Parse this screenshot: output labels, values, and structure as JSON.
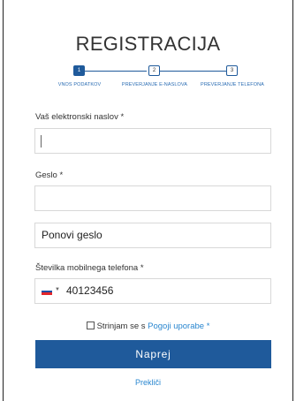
{
  "form": {
    "title": "REGISTRACIJA",
    "steps": [
      {
        "number": "1",
        "label": "VNOS PODATKOV",
        "active": true
      },
      {
        "number": "2",
        "label": "PREVERJANJE E-NASLOVA",
        "active": false
      },
      {
        "number": "3",
        "label": "PREVERJANJE TELEFONA",
        "active": false
      }
    ],
    "email": {
      "label": "Vaš elektronski naslov *",
      "value": ""
    },
    "password": {
      "label": "Geslo *",
      "value": ""
    },
    "repeat_password": {
      "placeholder": "Ponovi geslo"
    },
    "phone": {
      "label": "Številka mobilnega telefona *",
      "value": "40123456",
      "country_flag": "slovenia-flag-icon",
      "flag_colors": [
        "#ffffff",
        "#1f4fa5",
        "#e3262b"
      ]
    },
    "terms": {
      "prefix": "Strinjam se s",
      "link": "Pogoji uporabe *",
      "checked": false
    },
    "next_button": "Naprej",
    "cancel_link": "Prekliči"
  },
  "colors": {
    "primary": "#1f5a9b",
    "link": "#2a87d0"
  }
}
